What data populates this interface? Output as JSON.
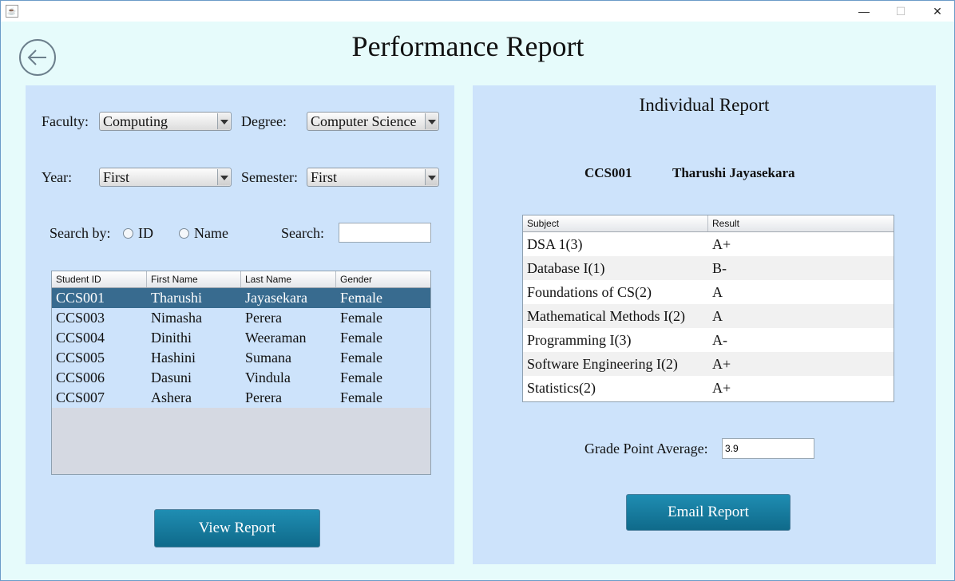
{
  "window": {
    "icon_name": "java-icon",
    "controls": {
      "minimize": "—",
      "maximize": "☐",
      "close": "✕"
    }
  },
  "title": "Performance Report",
  "back_icon": "back-arrow-icon",
  "filters": {
    "faculty_label": "Faculty:",
    "faculty_value": "Computing",
    "degree_label": "Degree:",
    "degree_value": "Computer Science",
    "year_label": "Year:",
    "year_value": "First",
    "semester_label": "Semester:",
    "semester_value": "First"
  },
  "search": {
    "by_label": "Search by:",
    "option_id": "ID",
    "option_name": "Name",
    "label": "Search:",
    "value": ""
  },
  "students_table": {
    "columns": [
      "Student ID",
      "First Name",
      "Last Name",
      "Gender"
    ],
    "rows": [
      [
        "CCS001",
        "Tharushi",
        "Jayasekara",
        "Female"
      ],
      [
        "CCS003",
        "Nimasha",
        "Perera",
        "Female"
      ],
      [
        "CCS004",
        "Dinithi",
        "Weeraman",
        "Female"
      ],
      [
        "CCS005",
        "Hashini",
        "Sumana",
        "Female"
      ],
      [
        "CCS006",
        "Dasuni",
        "Vindula",
        "Female"
      ],
      [
        "CCS007",
        "Ashera",
        "Perera",
        "Female"
      ]
    ],
    "selected_row": "CCS001"
  },
  "view_report_button": "View Report",
  "report": {
    "heading": "Individual Report",
    "student_id": "CCS001",
    "student_name": "Tharushi Jayasekara",
    "columns": [
      "Subject",
      "Result"
    ],
    "rows": [
      [
        "DSA 1(3)",
        "A+"
      ],
      [
        "Database I(1)",
        "B-"
      ],
      [
        "Foundations of CS(2)",
        "A"
      ],
      [
        "Mathematical Methods I(2)",
        "A"
      ],
      [
        "Programming I(3)",
        "A-"
      ],
      [
        "Software Engineering I(2)",
        "A+"
      ],
      [
        "Statistics(2)",
        "A+"
      ]
    ],
    "gpa_label": "Grade Point Average:",
    "gpa_value": "3.9"
  },
  "email_report_button": "Email Report",
  "colors": {
    "background": "#e6fbfb",
    "panel": "#cde3fb",
    "selected_row": "#386b8f",
    "button": "#1679a0"
  }
}
